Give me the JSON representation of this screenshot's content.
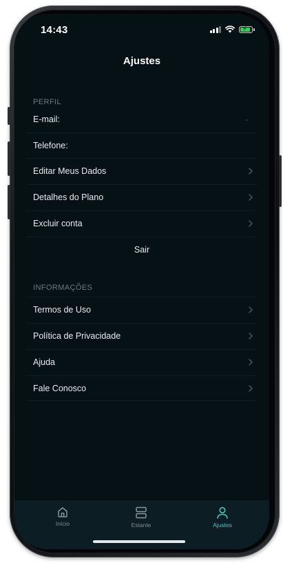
{
  "status_bar": {
    "time": "14:43",
    "battery_charging": true
  },
  "header": {
    "title": "Ajustes"
  },
  "sections": {
    "perfil": {
      "title": "PERFIL",
      "email_label": "E-mail:",
      "email_value": "-",
      "phone_label": "Telefone:",
      "edit_data_label": "Editar Meus Dados",
      "plan_details_label": "Detalhes do Plano",
      "delete_account_label": "Excluir conta",
      "logout_label": "Sair"
    },
    "informacoes": {
      "title": "INFORMAÇÕES",
      "terms_label": "Termos de Uso",
      "privacy_label": "Política de Privacidade",
      "help_label": "Ajuda",
      "contact_label": "Fale Conosco"
    }
  },
  "tabbar": {
    "home_label": "Início",
    "shelf_label": "Estante",
    "settings_label": "Ajustes",
    "active_tab": "Ajustes"
  },
  "colors": {
    "background": "#061116",
    "tabbar_background": "#0c1e24",
    "accent": "#3fc7c0",
    "text": "#e8ecee",
    "muted": "#6f7b80"
  },
  "icons": {
    "home": "house-icon",
    "shelf": "shelf-icon",
    "settings": "user-icon",
    "chevron": "chevron-right-icon"
  }
}
